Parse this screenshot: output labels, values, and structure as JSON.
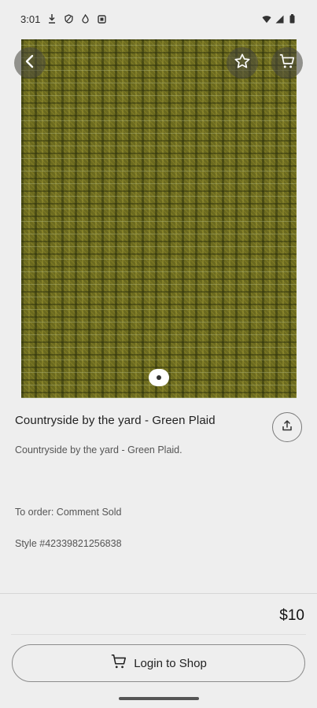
{
  "status_bar": {
    "time": "3:01",
    "left_icons": [
      "download-icon",
      "shield-icon",
      "flame-icon",
      "square-app-icon"
    ],
    "right_icons": [
      "wifi-icon",
      "signal-icon",
      "battery-icon"
    ]
  },
  "hero": {
    "icons": {
      "back": "chevron-left-icon",
      "favorite": "star-icon",
      "cart": "cart-icon"
    },
    "page_count": 1,
    "current_page": 1
  },
  "product": {
    "title": "Countryside by the yard - Green Plaid",
    "description": "Countryside by the yard - Green Plaid.",
    "order_note": "To order: Comment Sold",
    "style_number": "Style #42339821256838",
    "price": "$10"
  },
  "actions": {
    "share_icon": "share-icon",
    "login_label": "Login to Shop",
    "login_icon": "cart-icon"
  },
  "colors": {
    "background": "#eeeeee",
    "fabric_base": "#6b6a1f",
    "text_primary": "#222222",
    "text_secondary": "#555555"
  }
}
